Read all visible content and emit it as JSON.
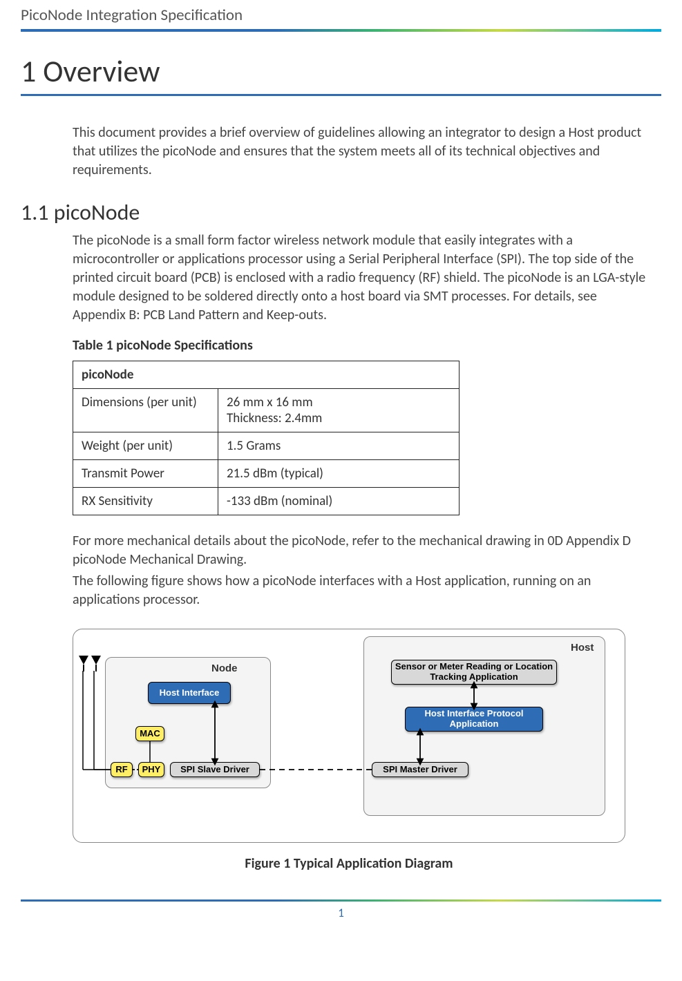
{
  "header": {
    "title": "PicoNode Integration Specification"
  },
  "section": {
    "number": "1",
    "title": "Overview",
    "full": "1 Overview"
  },
  "intro": "This document provides a brief overview of guidelines allowing an integrator to design a Host product that utilizes the picoNode and ensures that the system meets all of its technical objectives and requirements.",
  "subsection": {
    "number": "1.1",
    "title": "picoNode",
    "full": "1.1 picoNode"
  },
  "sub_intro": "The picoNode is a small form factor wireless network module that easily integrates with a microcontroller or applications processor using a Serial Peripheral Interface (SPI).  The top side of the printed circuit board (PCB) is enclosed with a radio frequency (RF) shield. The picoNode is an LGA-style module designed to be soldered directly onto a host board via SMT processes. For details, see Appendix B: PCB Land Pattern and Keep-outs.",
  "table": {
    "caption": "Table 1 picoNode Specifications",
    "header": "picoNode",
    "rows": [
      {
        "label": "Dimensions (per unit)",
        "value": "26 mm  x  16 mm\nThickness: 2.4mm"
      },
      {
        "label": "Weight (per unit)",
        "value": "1.5 Grams"
      },
      {
        "label": "Transmit Power",
        "value": " 21.5 dBm (typical)"
      },
      {
        "label": "RX Sensitivity",
        "value": " -133 dBm (nominal)"
      }
    ]
  },
  "post_table_1": "For more mechanical details about the picoNode, refer to the mechanical drawing in 0D Appendix D picoNode Mechanical Drawing.",
  "post_table_2": "The following figure shows how a picoNode interfaces with a Host application, running on an applications processor.",
  "figure": {
    "caption": "Figure 1 Typical Application Diagram",
    "node_label": "Node",
    "host_label": "Host",
    "blocks": {
      "host_interface": "Host Interface",
      "mac": "MAC",
      "rf": "RF",
      "phy": "PHY",
      "spi_slave": "SPI Slave Driver",
      "app_top": "Sensor or Meter Reading or Location Tracking Application",
      "hip": "Host Interface Protocol Application",
      "spi_master": "SPI Master Driver"
    }
  },
  "page_number": "1"
}
